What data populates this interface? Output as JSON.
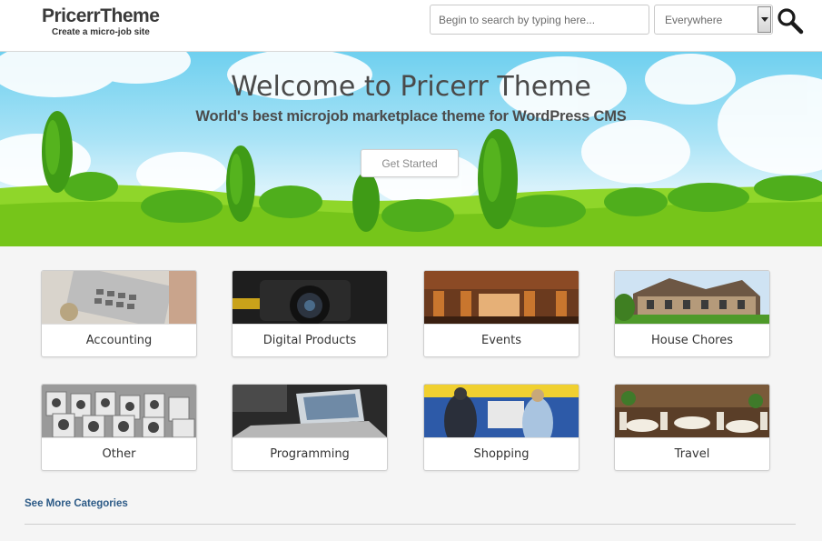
{
  "header": {
    "logo_title": "PricerrTheme",
    "logo_tagline": "Create a micro-job site",
    "search_placeholder": "Begin to search by typing here...",
    "scope_value": "Everywhere"
  },
  "hero": {
    "title": "Welcome to Pricerr Theme",
    "subtitle": "World's best microjob marketplace theme for WordPress CMS",
    "cta_label": "Get Started"
  },
  "categories": [
    {
      "label": "Accounting",
      "icon": "calculator-photo"
    },
    {
      "label": "Digital Products",
      "icon": "camera-photo"
    },
    {
      "label": "Events",
      "icon": "restaurant-interior-photo"
    },
    {
      "label": "House Chores",
      "icon": "house-photo"
    },
    {
      "label": "Other",
      "icon": "frames-photo"
    },
    {
      "label": "Programming",
      "icon": "laptop-photo"
    },
    {
      "label": "Shopping",
      "icon": "shoppers-photo"
    },
    {
      "label": "Travel",
      "icon": "dining-room-photo"
    }
  ],
  "footer": {
    "see_more_label": "See More Categories"
  },
  "colors": {
    "link": "#2c5a86",
    "grass": "#7ccf1e",
    "sky": "#6fd0ef"
  }
}
